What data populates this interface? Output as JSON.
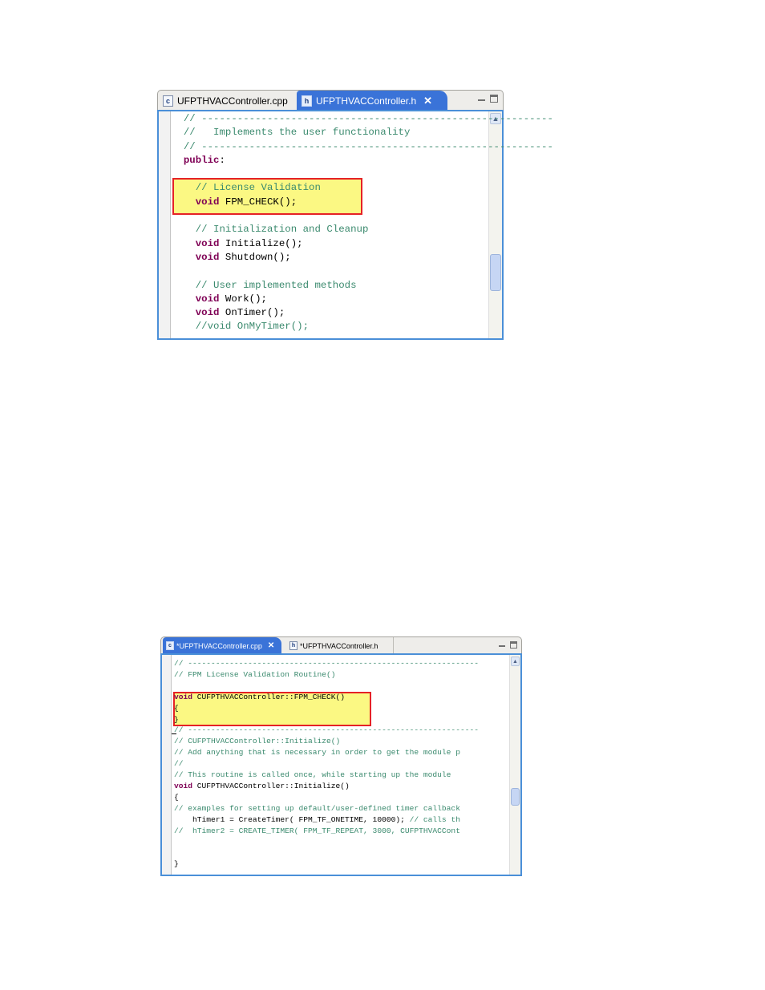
{
  "top_editor": {
    "tabs": [
      {
        "icon": "c",
        "label": "UFPTHVACController.cpp",
        "active": false,
        "closable": false
      },
      {
        "icon": "h",
        "label": "UFPTHVACController.h",
        "active": true,
        "closable": true
      }
    ],
    "lines": [
      [
        {
          "t": "cm",
          "s": "  // -----------------------------------------------------------"
        }
      ],
      [
        {
          "t": "cm",
          "s": "  //   Implements the user functionality"
        }
      ],
      [
        {
          "t": "cm",
          "s": "  // -----------------------------------------------------------"
        }
      ],
      [
        {
          "t": "kw",
          "s": "  public"
        },
        {
          "t": "",
          "s": ":"
        }
      ],
      [
        {
          "t": "",
          "s": ""
        }
      ],
      [
        {
          "t": "cm",
          "s": "    // License Validation"
        }
      ],
      [
        {
          "t": "kw",
          "s": "    void"
        },
        {
          "t": "",
          "s": " FPM_CHECK();"
        }
      ],
      [
        {
          "t": "",
          "s": ""
        }
      ],
      [
        {
          "t": "cm",
          "s": "    // Initialization and Cleanup"
        }
      ],
      [
        {
          "t": "kw",
          "s": "    void"
        },
        {
          "t": "",
          "s": " Initialize();"
        }
      ],
      [
        {
          "t": "kw",
          "s": "    void"
        },
        {
          "t": "",
          "s": " Shutdown();"
        }
      ],
      [
        {
          "t": "",
          "s": ""
        }
      ],
      [
        {
          "t": "cm",
          "s": "    // User implemented methods"
        }
      ],
      [
        {
          "t": "kw",
          "s": "    void"
        },
        {
          "t": "",
          "s": " Work();"
        }
      ],
      [
        {
          "t": "kw",
          "s": "    void"
        },
        {
          "t": "",
          "s": " OnTimer();"
        }
      ],
      [
        {
          "t": "cm",
          "s": "    //void OnMyTimer();"
        }
      ]
    ]
  },
  "bottom_editor": {
    "tabs": [
      {
        "icon": "c",
        "label": "*UFPTHVACController.cpp",
        "active": true,
        "closable": true
      },
      {
        "icon": "h",
        "label": "*UFPTHVACController.h",
        "active": false,
        "closable": false
      }
    ],
    "lines": [
      [
        {
          "t": "cm",
          "s": "// ---------------------------------------------------------------"
        }
      ],
      [
        {
          "t": "cm",
          "s": "// FPM License Validation Routine()"
        }
      ],
      [
        {
          "t": "",
          "s": ""
        }
      ],
      [
        {
          "t": "kw",
          "s": "void"
        },
        {
          "t": "",
          "s": " CUFPTHVACController::FPM_CHECK()"
        }
      ],
      [
        {
          "t": "",
          "s": "{"
        }
      ],
      [
        {
          "t": "",
          "s": "}"
        }
      ],
      [
        {
          "t": "cm",
          "s": "// ---------------------------------------------------------------"
        }
      ],
      [
        {
          "t": "cm",
          "s": "// CUFPTHVACController::Initialize()"
        }
      ],
      [
        {
          "t": "cm",
          "s": "// Add anything that is necessary in order to get the module p"
        }
      ],
      [
        {
          "t": "cm",
          "s": "//"
        }
      ],
      [
        {
          "t": "cm",
          "s": "// This routine is called once, while starting up the module"
        }
      ],
      [
        {
          "t": "kw",
          "s": "void"
        },
        {
          "t": "",
          "s": " CUFPTHVACController::Initialize()"
        }
      ],
      [
        {
          "t": "",
          "s": "{"
        }
      ],
      [
        {
          "t": "cm",
          "s": "// examples for setting up default/user-defined timer callback"
        }
      ],
      [
        {
          "t": "",
          "s": "    hTimer1 = CreateTimer( FPM_TF_ONETIME, 10000); "
        },
        {
          "t": "cm",
          "s": "// calls th"
        }
      ],
      [
        {
          "t": "cm",
          "s": "//  hTimer2 = CREATE_TIMER( FPM_TF_REPEAT, 3000, CUFPTHVACCont"
        }
      ],
      [
        {
          "t": "",
          "s": ""
        }
      ],
      [
        {
          "t": "",
          "s": ""
        }
      ],
      [
        {
          "t": "",
          "s": "}"
        }
      ]
    ]
  }
}
